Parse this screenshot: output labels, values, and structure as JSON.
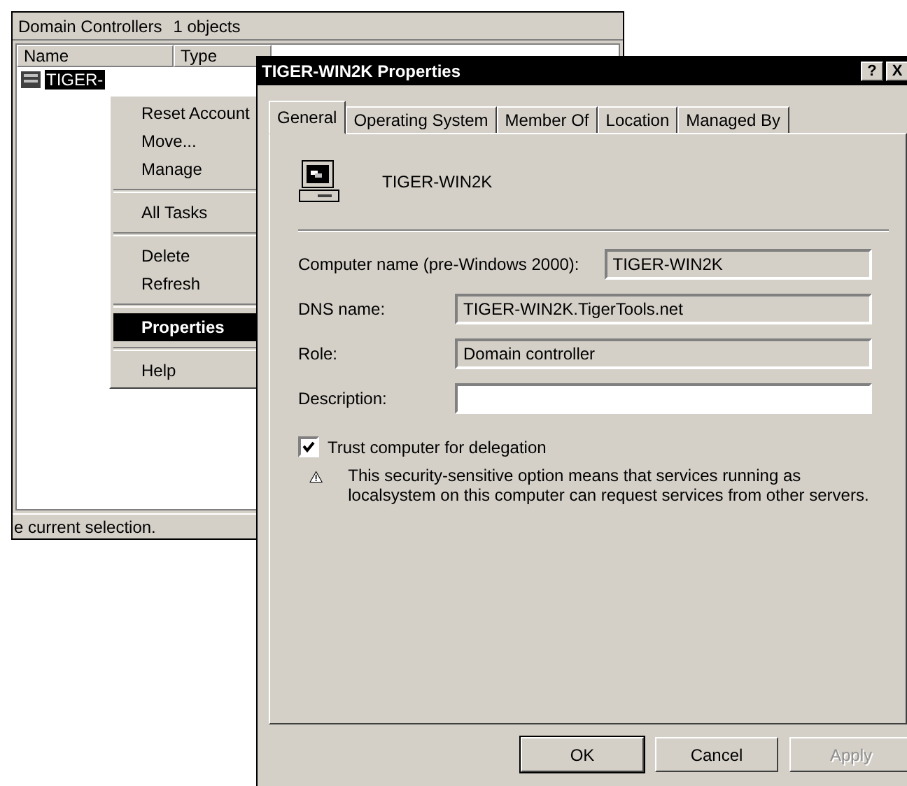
{
  "background_window": {
    "header": {
      "title": "Domain Controllers",
      "count": "1 objects"
    },
    "columns": [
      "Name",
      "Type"
    ],
    "rows": [
      {
        "name": "TIGER-",
        "selected": true
      }
    ],
    "status_bar": "e current selection."
  },
  "context_menu": {
    "items": [
      {
        "kind": "item",
        "label": "Reset Account",
        "selected": false,
        "default": false
      },
      {
        "kind": "item",
        "label": "Move...",
        "selected": false,
        "default": false
      },
      {
        "kind": "item",
        "label": "Manage",
        "selected": false,
        "default": false
      },
      {
        "kind": "separator"
      },
      {
        "kind": "item",
        "label": "All Tasks",
        "selected": false,
        "default": false
      },
      {
        "kind": "separator"
      },
      {
        "kind": "item",
        "label": "Delete",
        "selected": false,
        "default": false
      },
      {
        "kind": "item",
        "label": "Refresh",
        "selected": false,
        "default": false
      },
      {
        "kind": "separator"
      },
      {
        "kind": "item",
        "label": "Properties",
        "selected": true,
        "default": true
      },
      {
        "kind": "separator"
      },
      {
        "kind": "item",
        "label": "Help",
        "selected": false,
        "default": false
      }
    ]
  },
  "dialog": {
    "title": "TIGER-WIN2K Properties",
    "title_buttons": [
      "?",
      "X"
    ],
    "tabs": [
      {
        "label": "General",
        "selected": true
      },
      {
        "label": "Operating System",
        "selected": false
      },
      {
        "label": "Member Of",
        "selected": false
      },
      {
        "label": "Location",
        "selected": false
      },
      {
        "label": "Managed By",
        "selected": false
      }
    ],
    "object_name": "TIGER-WIN2K",
    "fields": [
      {
        "label": "Computer name (pre-Windows 2000):",
        "value": "TIGER-WIN2K",
        "read_only": true
      },
      {
        "label": "DNS name:",
        "value": "TIGER-WIN2K.TigerTools.net",
        "read_only": true
      },
      {
        "label": "Role:",
        "value": "Domain controller",
        "read_only": true
      },
      {
        "label": "Description:",
        "read_only": false
      }
    ],
    "checkbox": {
      "label": "Trust computer for delegation",
      "checked": true
    },
    "warning": "This security-sensitive option means that services running as localsystem on this computer can request services from other servers.",
    "buttons": [
      {
        "label": "OK",
        "default": true,
        "disabled": false
      },
      {
        "label": "Cancel",
        "default": false,
        "disabled": false
      },
      {
        "label": "Apply",
        "default": false,
        "disabled": true
      }
    ]
  }
}
